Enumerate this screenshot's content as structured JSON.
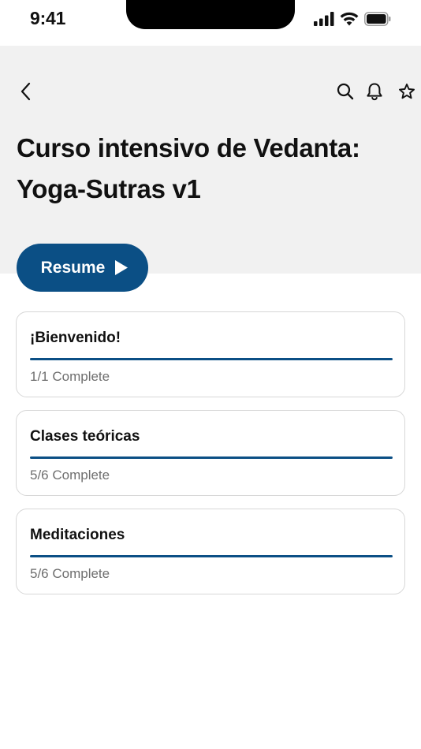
{
  "status_bar": {
    "time": "9:41"
  },
  "header": {
    "title": "Curso intensivo de Vedanta: Yoga-Sutras v1",
    "icons": [
      "back-chevron-icon",
      "search-icon",
      "bell-icon",
      "star-icon"
    ]
  },
  "resume_button": {
    "label": "Resume"
  },
  "modules": [
    {
      "title": "¡Bienvenido!",
      "status": "1/1 Complete",
      "progress": 1.0
    },
    {
      "title": "Clases teóricas",
      "status": "5/6 Complete",
      "progress": 1.0
    },
    {
      "title": "Meditaciones",
      "status": "5/6 Complete",
      "progress": 1.0
    }
  ],
  "colors": {
    "accent": "#0b4f85",
    "header_bg": "#f1f1f1",
    "muted_text": "#6f6f6f"
  }
}
